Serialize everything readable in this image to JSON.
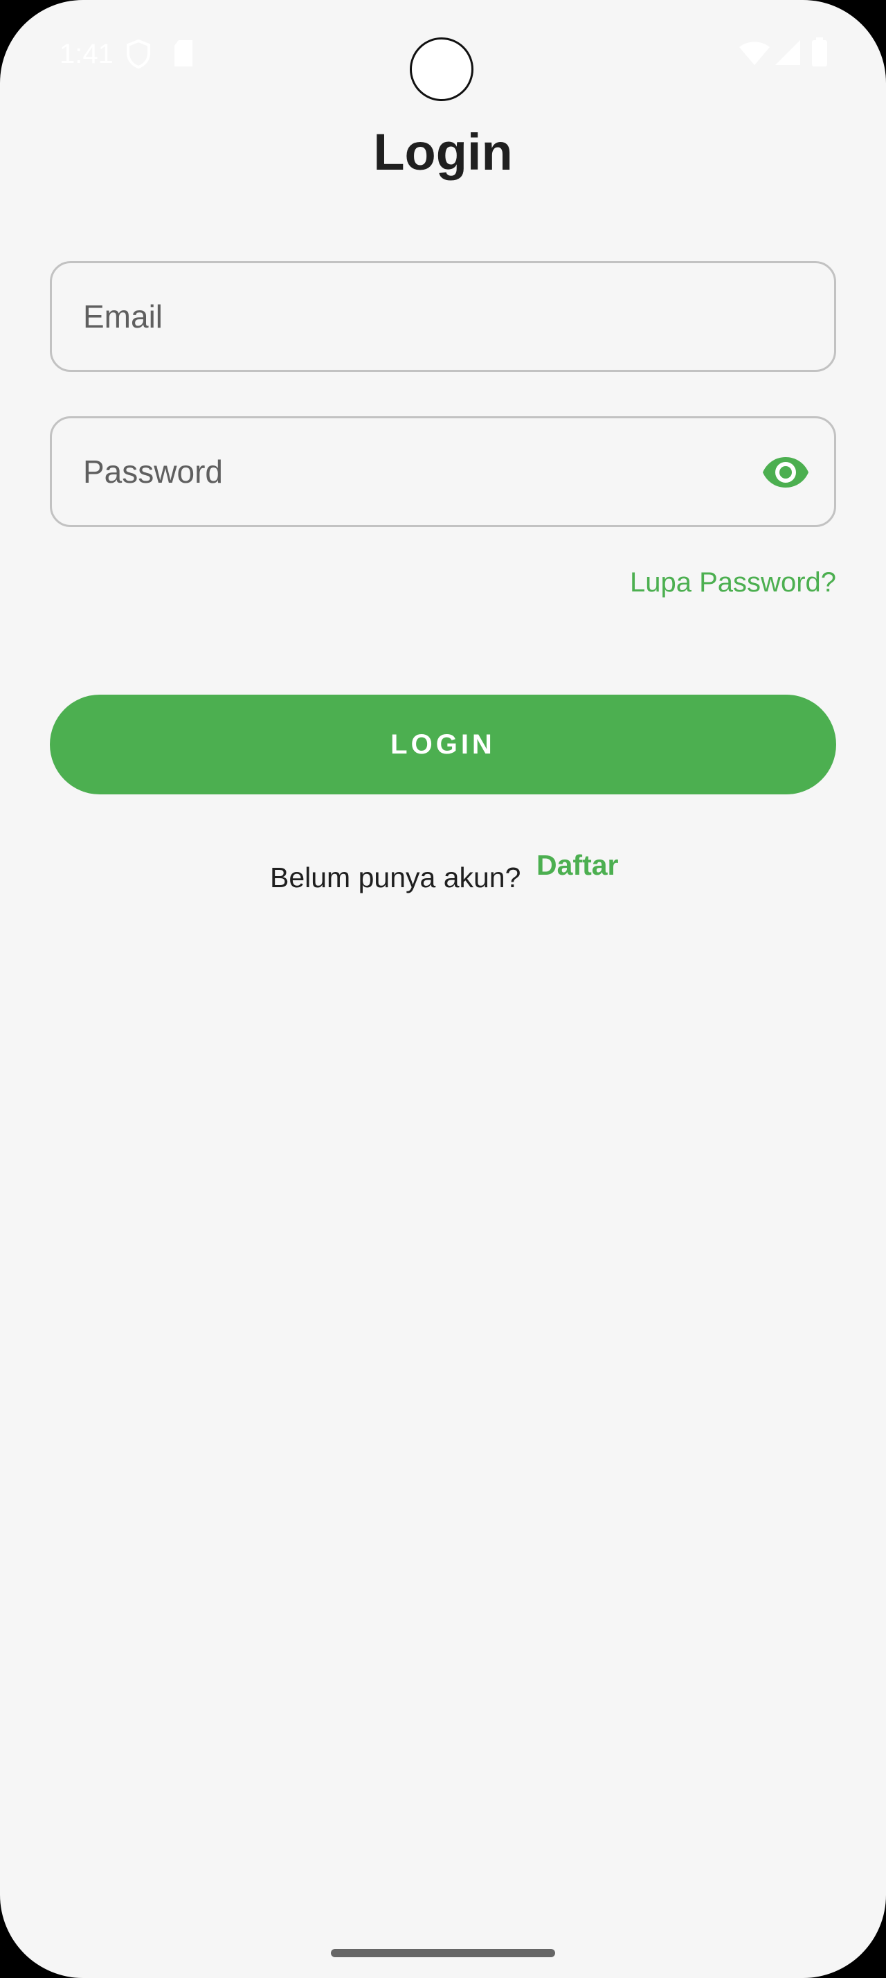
{
  "status_bar": {
    "time": "1:41",
    "icons": [
      "shield-icon",
      "sd-card-icon",
      "wifi-icon",
      "signal-icon",
      "battery-icon"
    ],
    "text_color": "#ffffff"
  },
  "screen": {
    "title": "Login",
    "background_color": "#f6f6f6"
  },
  "form": {
    "email": {
      "placeholder": "Email",
      "value": ""
    },
    "password": {
      "placeholder": "Password",
      "value": "",
      "toggle_icon": "eye-icon"
    },
    "forgot_password_label": "Lupa Password?",
    "login_button_label": "LOGIN",
    "register_prompt": "Belum punya akun?",
    "register_link_label": "Daftar"
  },
  "colors": {
    "accent": "#4caf50",
    "text_primary": "#1f1f1f",
    "placeholder": "#5f5f5f",
    "field_border": "#c2c2c2"
  }
}
